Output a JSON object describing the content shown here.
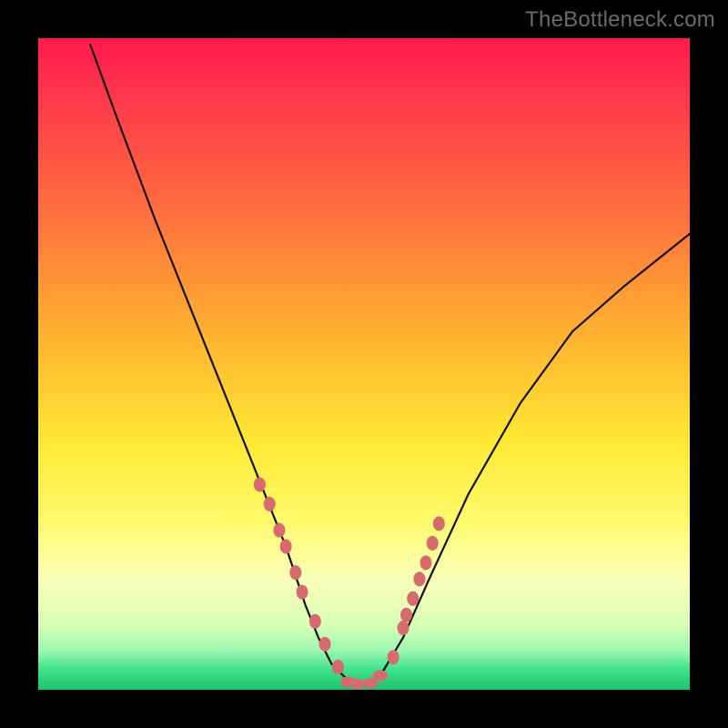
{
  "watermark": "TheBottleneck.com",
  "chart_data": {
    "type": "line",
    "title": "",
    "xlabel": "",
    "ylabel": "",
    "xlim": [
      0,
      100
    ],
    "ylim": [
      0,
      100
    ],
    "grid": false,
    "curve_x": [
      8,
      12,
      18,
      24,
      30,
      34,
      38,
      41,
      43,
      45,
      47,
      49,
      51,
      53,
      56,
      60,
      66,
      74,
      82,
      90,
      100
    ],
    "curve_y": [
      99,
      88,
      72,
      57,
      42,
      32,
      22,
      13,
      8,
      4,
      2,
      1,
      1,
      3,
      8,
      17,
      30,
      44,
      55,
      62,
      70
    ],
    "markers": {
      "left_x": [
        34.0,
        35.5,
        37.0,
        38.0,
        39.5,
        40.5,
        42.5,
        44.0,
        46.0
      ],
      "left_y": [
        31.5,
        28.5,
        24.5,
        22.0,
        18.0,
        15.0,
        10.5,
        7.0,
        3.5
      ],
      "bottom_x": [
        47.5,
        49.0,
        51.0,
        52.5
      ],
      "bottom_y": [
        1.2,
        0.9,
        1.0,
        2.2
      ],
      "right_x": [
        54.5,
        56.0,
        56.5,
        57.5,
        58.5,
        59.5,
        60.5,
        61.5
      ],
      "right_y": [
        5.0,
        9.5,
        11.5,
        14.0,
        17.0,
        19.5,
        22.5,
        25.5
      ]
    },
    "marker_color": "#d86a6f",
    "curve_color": "#111111"
  }
}
